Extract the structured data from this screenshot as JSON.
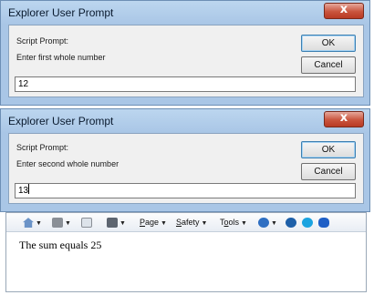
{
  "dialogs": [
    {
      "title": "Explorer User Prompt",
      "close_glyph": "x",
      "prompt_label": "Script Prompt:",
      "message": "Enter first whole number",
      "ok_label": "OK",
      "cancel_label": "Cancel",
      "input_value": "12"
    },
    {
      "title": "Explorer User Prompt",
      "close_glyph": "x",
      "prompt_label": "Script Prompt:",
      "message": "Enter second whole number",
      "ok_label": "OK",
      "cancel_label": "Cancel",
      "input_value": "13"
    }
  ],
  "toolbar": {
    "icons": [
      "home-icon",
      "feeds-icon",
      "mail-icon",
      "print-icon",
      "help-icon",
      "hp-icon",
      "skype-icon",
      "bluetooth-icon"
    ],
    "page_menu": "Page",
    "safety_menu": "Safety",
    "tools_menu": "Tools"
  },
  "page": {
    "result_text": "The sum equals 25"
  }
}
